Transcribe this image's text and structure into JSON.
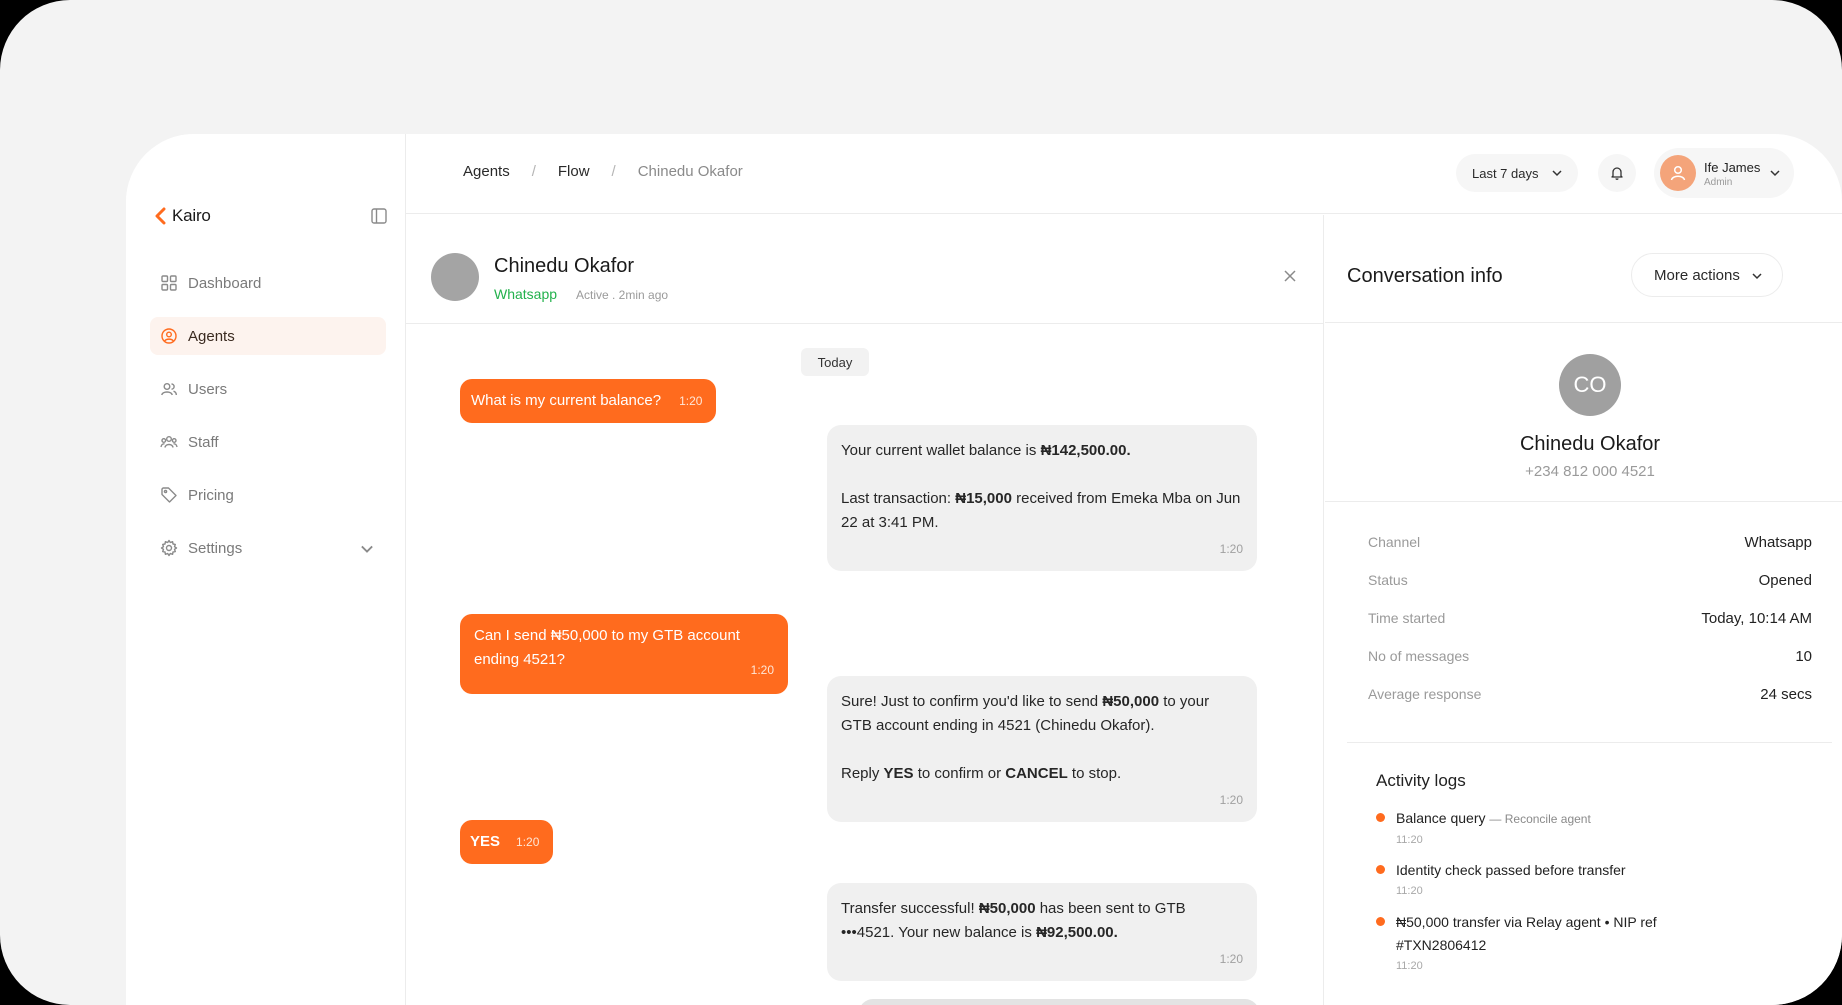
{
  "brand": {
    "name": "Kairo",
    "accent": "#ff6b1e"
  },
  "sidebar": {
    "items": [
      {
        "label": "Dashboard",
        "icon": "grid-icon"
      },
      {
        "label": "Agents",
        "icon": "user-circle-icon",
        "active": true
      },
      {
        "label": "Users",
        "icon": "users-icon"
      },
      {
        "label": "Staff",
        "icon": "team-icon"
      },
      {
        "label": "Pricing",
        "icon": "tag-icon"
      },
      {
        "label": "Settings",
        "icon": "gear-icon",
        "expandable": true
      }
    ]
  },
  "breadcrumb": [
    "Agents",
    "Flow",
    "Chinedu Okafor"
  ],
  "header": {
    "range_label": "Last 7 days",
    "user": {
      "name": "Ife James",
      "role": "Admin"
    }
  },
  "chat": {
    "contact_name": "Chinedu Okafor",
    "channel": "Whatsapp",
    "status": "Active . 2min ago",
    "day_label": "Today",
    "messages": [
      {
        "from": "user",
        "text": "What is my current balance?",
        "time": "1:20"
      },
      {
        "from": "agent",
        "html": "Your current wallet balance is <b>₦142,500.00.</b>\n\nLast transaction: <b>₦15,000</b> received from Emeka Mba on Jun 22 at 3:41 PM.",
        "time": "1:20"
      },
      {
        "from": "user",
        "text": "Can I send ₦50,000 to my GTB account ending 4521?",
        "time": "1:20"
      },
      {
        "from": "agent",
        "html": "Sure! Just to confirm you'd like to send <b>₦50,000</b> to your GTB account ending in 4521 (Chinedu Okafor).\n\nReply <b>YES</b> to confirm or <b>CANCEL</b> to stop.",
        "time": "1:20"
      },
      {
        "from": "user",
        "text": "YES",
        "time": "1:20"
      },
      {
        "from": "agent",
        "html": "Transfer successful! <b>₦50,000</b> has been sent to GTB •••4521. Your new balance is <b>₦92,500.00.</b>",
        "time": "1:20"
      }
    ]
  },
  "info": {
    "title": "Conversation info",
    "more_actions": "More actions",
    "initials": "CO",
    "name": "Chinedu Okafor",
    "phone": "+234 812 000 4521",
    "details": [
      {
        "key": "Channel",
        "value": "Whatsapp"
      },
      {
        "key": "Status",
        "value": "Opened"
      },
      {
        "key": "Time started",
        "value": "Today, 10:14 AM"
      },
      {
        "key": "No of messages",
        "value": "10"
      },
      {
        "key": "Average response",
        "value": "24 secs"
      }
    ],
    "logs_title": "Activity logs",
    "logs": [
      {
        "text": "Balance query",
        "sub": "— Reconcile agent",
        "time": "11:20"
      },
      {
        "text": "Identity check passed before transfer",
        "sub": "",
        "time": "11:20"
      },
      {
        "text": "₦50,000 transfer via Relay agent • NIP ref #TXN2806412",
        "sub": "",
        "time": "11:20"
      }
    ]
  }
}
